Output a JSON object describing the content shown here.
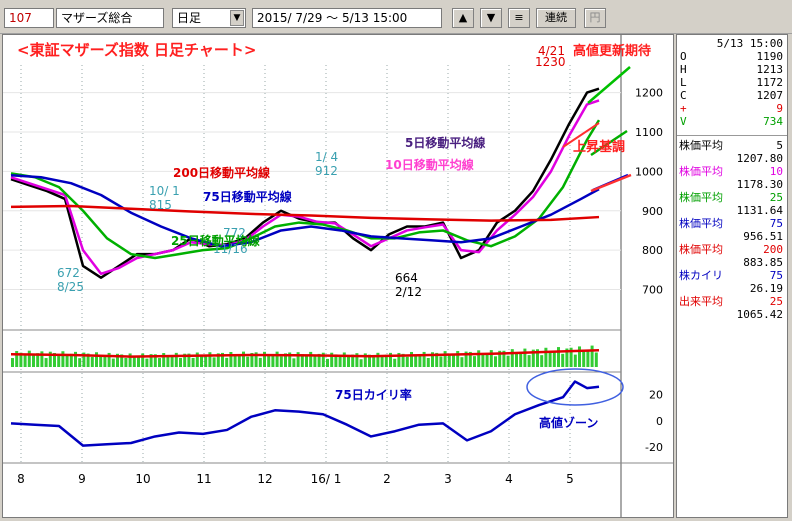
{
  "toolbar": {
    "code": "107",
    "name": "マザーズ総合",
    "period": "日足",
    "range": "2015/ 7/29 ～ 5/13 15:00",
    "btn_up": "▲",
    "btn_down": "▼",
    "btn_menu": "≡",
    "btn_continuous": "連続",
    "btn_yen": "円"
  },
  "panel": {
    "date": "5/13 15:00",
    "ohlc": [
      {
        "k": "O",
        "v": "1190"
      },
      {
        "k": "H",
        "v": "1213"
      },
      {
        "k": "L",
        "v": "1172"
      },
      {
        "k": "C",
        "v": "1207"
      },
      {
        "k": "+",
        "v": "9"
      },
      {
        "k": "V",
        "v": "734"
      }
    ],
    "indicators": [
      {
        "name": "株価平均",
        "param": "5",
        "value": "1207.80",
        "color": "#000000"
      },
      {
        "name": "株価平均",
        "param": "10",
        "value": "1178.30",
        "color": "#e000e0"
      },
      {
        "name": "株価平均",
        "param": "25",
        "value": "1131.64",
        "color": "#00a000"
      },
      {
        "name": "株価平均",
        "param": "75",
        "value": "956.51",
        "color": "#0000c0"
      },
      {
        "name": "株価平均",
        "param": "200",
        "value": "883.85",
        "color": "#e00000"
      },
      {
        "name": "株カイリ",
        "param": "75",
        "value": "26.19",
        "color": "#0000c0"
      },
      {
        "name": "出来平均",
        "param": "25",
        "value": "1065.42",
        "color": "#e00000"
      }
    ]
  },
  "chart_data": {
    "type": "line",
    "title": "<東証マザーズ指数 日足チャート>",
    "x_month_labels": [
      "8",
      "9",
      "10",
      "11",
      "12",
      "16/ 1",
      "2",
      "3",
      "4",
      "5"
    ],
    "price_axis": {
      "ticks": [
        1200,
        1100,
        1000,
        900,
        800,
        700
      ],
      "ylim": [
        610,
        1270
      ]
    },
    "deviation_axis": {
      "ticks": [
        20,
        0,
        -20
      ],
      "ylim": [
        -30,
        35
      ]
    },
    "annotations": {
      "high_date": "4/21",
      "high_value": "1230",
      "high_note": "高値更新期待",
      "low1_value": "672",
      "low1_date": "8/25",
      "low2_value": "664",
      "low2_date": "2/12",
      "mid_date_a": "1/ 4",
      "mid_value_a": "912",
      "mid_date_b": "10/ 1",
      "mid_value_b": "815",
      "mid_date_c": "11/16",
      "mid_value_c": "772",
      "ma5_label": "5日移動平均線",
      "ma10_label": "10日移動平均線",
      "ma25_label": "25日移動平均線",
      "ma75_label": "75日移動平均線",
      "ma200_label": "200日移動平均線",
      "uptrend_label": "上昇基調",
      "dev_label": "75日カイリ率",
      "high_zone_label": "高値ゾーン"
    },
    "series": [
      {
        "name": "5日移動平均線",
        "color": "#000000",
        "x": [
          0,
          3,
          6,
          9,
          12,
          15,
          18,
          21,
          24,
          27,
          30,
          33,
          36,
          39,
          42,
          45,
          48,
          51,
          54,
          57,
          60,
          63,
          66,
          69,
          72,
          75,
          78,
          81,
          84,
          87,
          90,
          93,
          96,
          98
        ],
        "values": [
          980,
          965,
          950,
          930,
          760,
          730,
          760,
          790,
          790,
          800,
          830,
          810,
          815,
          830,
          870,
          900,
          880,
          870,
          870,
          830,
          800,
          840,
          860,
          860,
          870,
          780,
          800,
          870,
          900,
          950,
          1030,
          1120,
          1200,
          1210
        ]
      },
      {
        "name": "10日移動平均線",
        "color": "#e000e0",
        "x": [
          0,
          3,
          6,
          9,
          12,
          15,
          18,
          21,
          24,
          27,
          30,
          33,
          36,
          39,
          42,
          45,
          48,
          51,
          54,
          57,
          60,
          63,
          66,
          69,
          72,
          75,
          78,
          81,
          84,
          87,
          90,
          93,
          96,
          98
        ],
        "values": [
          985,
          970,
          955,
          940,
          800,
          740,
          755,
          780,
          790,
          800,
          820,
          815,
          812,
          825,
          860,
          890,
          885,
          872,
          868,
          840,
          810,
          830,
          850,
          858,
          865,
          800,
          795,
          850,
          890,
          935,
          1000,
          1090,
          1170,
          1180
        ]
      },
      {
        "name": "25日移動平均線",
        "color": "#00b000",
        "x": [
          0,
          4,
          8,
          12,
          16,
          20,
          24,
          28,
          32,
          36,
          40,
          44,
          48,
          52,
          56,
          60,
          64,
          68,
          72,
          76,
          80,
          84,
          88,
          92,
          96,
          98
        ],
        "values": [
          995,
          985,
          960,
          900,
          830,
          790,
          780,
          790,
          800,
          805,
          830,
          860,
          870,
          865,
          850,
          830,
          830,
          845,
          850,
          825,
          810,
          835,
          880,
          960,
          1080,
          1130
        ]
      },
      {
        "name": "75日移動平均線",
        "color": "#0000c0",
        "x": [
          0,
          5,
          10,
          15,
          20,
          25,
          30,
          35,
          40,
          45,
          50,
          55,
          60,
          65,
          70,
          75,
          80,
          85,
          90,
          95,
          98
        ],
        "values": [
          990,
          985,
          970,
          940,
          895,
          860,
          830,
          810,
          820,
          850,
          860,
          850,
          835,
          830,
          825,
          820,
          830,
          860,
          890,
          930,
          955
        ]
      },
      {
        "name": "200日移動平均線",
        "color": "#e00000",
        "x": [
          0,
          10,
          20,
          30,
          40,
          50,
          60,
          70,
          80,
          90,
          98
        ],
        "values": [
          910,
          912,
          905,
          898,
          892,
          888,
          882,
          878,
          875,
          877,
          884
        ]
      }
    ],
    "deviation": {
      "name": "75日カイリ率",
      "color": "#0000c0",
      "x": [
        0,
        4,
        8,
        12,
        16,
        20,
        24,
        28,
        32,
        36,
        40,
        44,
        48,
        52,
        56,
        60,
        64,
        68,
        72,
        76,
        80,
        84,
        88,
        92,
        94,
        96,
        98
      ],
      "values": [
        -2,
        -3,
        -4,
        -19,
        -18,
        -17,
        -12,
        -9,
        -10,
        -7,
        3,
        8,
        7,
        5,
        -3,
        -12,
        -8,
        -3,
        -2,
        -15,
        -8,
        5,
        12,
        18,
        30,
        25,
        26
      ]
    },
    "volume": {
      "x": [
        0,
        10,
        20,
        30,
        40,
        50,
        60,
        70,
        80,
        90,
        98
      ],
      "values": [
        320,
        300,
        260,
        280,
        300,
        290,
        270,
        300,
        330,
        380,
        420
      ],
      "avg_color": "#e00000",
      "bar_color": "#33cc33"
    }
  }
}
